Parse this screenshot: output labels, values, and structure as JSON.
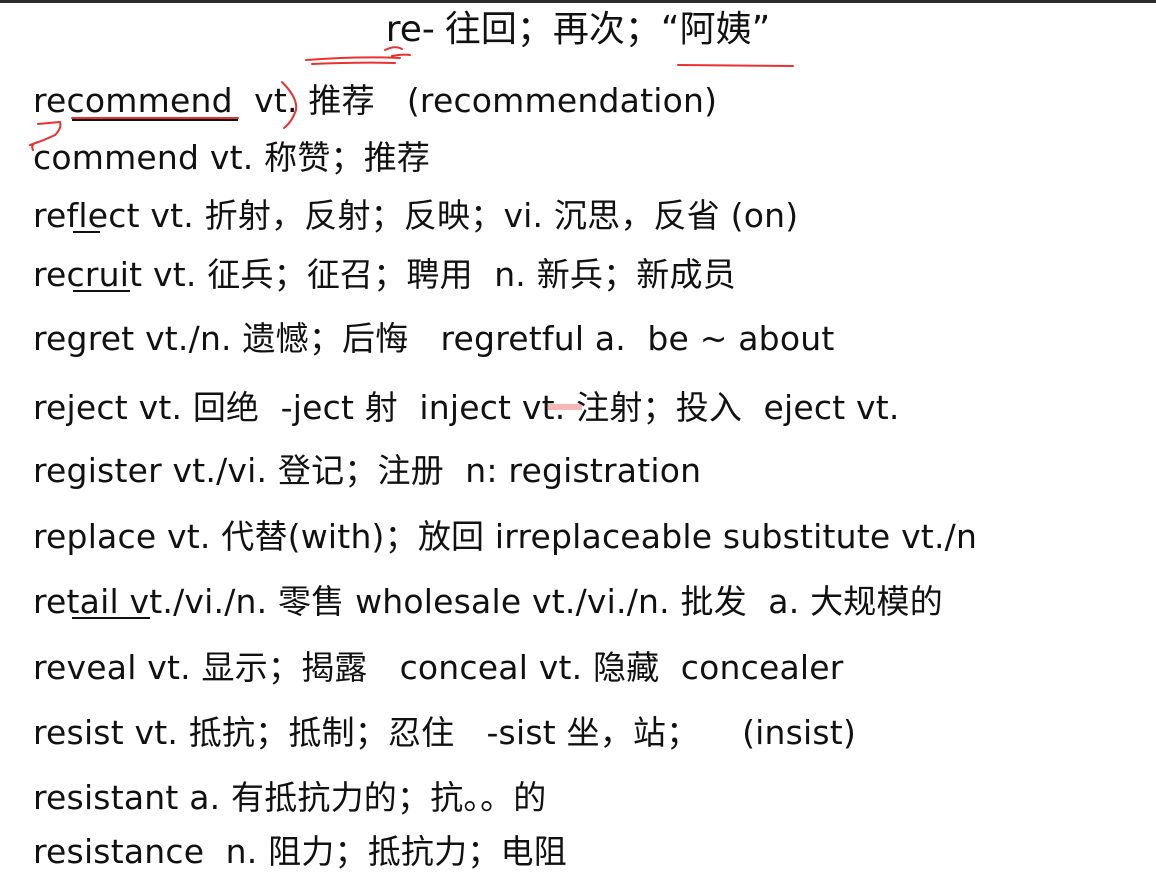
{
  "title": {
    "prefix": "re-",
    "meaning": "往回；再次；“阿姨”"
  },
  "entries": [
    "recommend  vt. 推荐   (recommendation)",
    "commend vt. 称赞；推荐",
    "reflect vt. 折射，反射；反映；vi. 沉思，反省 (on)",
    "recruit vt. 征兵；征召；聘用  n. 新兵；新成员",
    "regret vt./n. 遗憾；后悔   regretful a.  be ~ about",
    "reject vt. 回绝  -ject 射  inject vt. 注射；投入  eject vt.",
    "register vt./vi. 登记；注册  n: registration",
    "replace vt. 代替(with)；放回 irreplaceable substitute vt./n",
    "retail vt./vi./n. 零售 wholesale vt./vi./n. 批发  a. 大规模的",
    "reveal vt. 显示；揭露   conceal vt. 隐藏  concealer",
    "resist vt. 抵抗；抵制；忍住   -sist 坐，站；    (insist)",
    "resistant a. 有抵抗力的；抗。。的",
    "resistance  n. 阻力；抵抗力；电阻"
  ],
  "colors": {
    "text": "#111111",
    "annotation": "#e8322f",
    "border": "#2b2b2b"
  }
}
